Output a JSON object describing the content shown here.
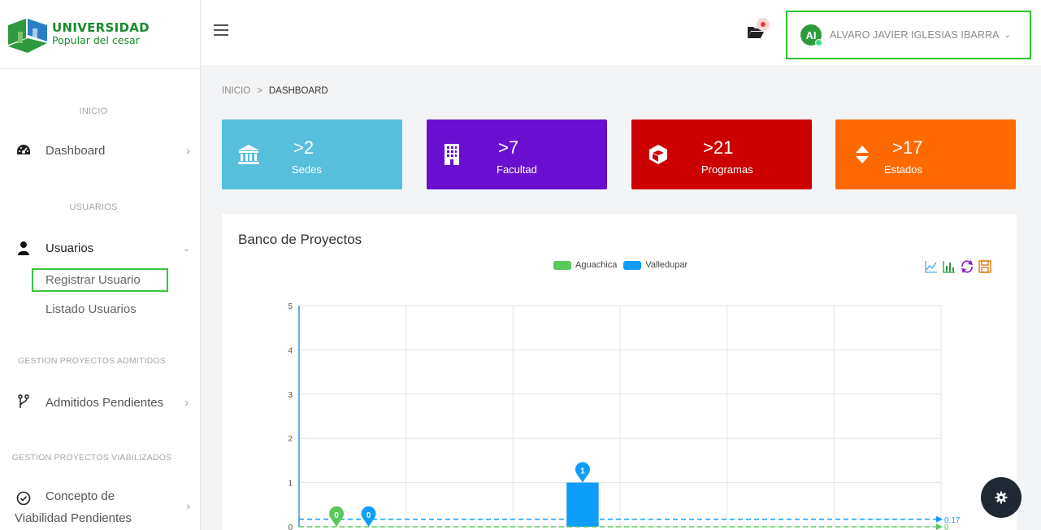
{
  "logo": {
    "line1": "UNIVERSIDAD",
    "line2": "Popular del cesar"
  },
  "sidebar": {
    "sections": [
      {
        "title": "INICIO"
      },
      {
        "title": "USUARIOS"
      },
      {
        "title": "GESTION PROYECTOS ADMITIDOS"
      },
      {
        "title": "GESTION PROYECTOS VIABILIZADOS"
      }
    ],
    "items": [
      {
        "label": "Dashboard",
        "icon": "dashboard-icon"
      },
      {
        "label": "Usuarios",
        "icon": "user-icon"
      },
      {
        "label": "Admitidos Pendientes",
        "icon": "branch-icon"
      },
      {
        "label": "Concepto de",
        "label2": "Viabilidad Pendientes",
        "icon": "check-circle-icon"
      }
    ],
    "sub_items": [
      {
        "label": "Registrar Usuario"
      },
      {
        "label": "Listado Usuarios"
      }
    ]
  },
  "header": {
    "user": {
      "initials": "AI",
      "name": "ALVARO JAVIER IGLESIAS IBARRA"
    }
  },
  "breadcrumb": {
    "home": "INICIO",
    "separator": ">",
    "current": "DASHBOARD"
  },
  "cards": [
    {
      "value": ">2",
      "label": "Sedes",
      "color": "#55bfdc",
      "icon": "bank-icon"
    },
    {
      "value": ">7",
      "label": "Facultad",
      "color": "#6a0fd0",
      "icon": "building-icon"
    },
    {
      "value": ">21",
      "label": "Programas",
      "color": "#cc0000",
      "icon": "cube-icon"
    },
    {
      "value": ">17",
      "label": "Estados",
      "color": "#ff6a00",
      "icon": "sort-icon"
    }
  ],
  "chart": {
    "title": "Banco de Proyectos",
    "toolbox": [
      "line-chart-icon",
      "bar-chart-icon",
      "refresh-icon",
      "save-icon"
    ]
  },
  "chart_data": {
    "type": "bar",
    "categories": [
      "",
      "",
      "",
      "",
      "",
      ""
    ],
    "series": [
      {
        "name": "Aguachica",
        "color": "#5ac85a",
        "values": [
          0,
          0,
          0,
          0,
          0,
          0
        ],
        "markers": [
          {
            "category": 0,
            "value": 0,
            "label": "0"
          }
        ],
        "mark_line": {
          "value": 0,
          "label": "0"
        }
      },
      {
        "name": "Valledupar",
        "color": "#0f9dfa",
        "values": [
          0,
          0,
          1,
          0,
          0,
          0
        ],
        "markers": [
          {
            "category": 0,
            "value": 0,
            "label": "0"
          },
          {
            "category": 2,
            "value": 1,
            "label": "1"
          }
        ],
        "mark_line": {
          "value": 0.17,
          "label": "0.17"
        }
      }
    ],
    "ylim": [
      0,
      5
    ],
    "yticks": [
      "0",
      "1",
      "2",
      "3",
      "4",
      "5"
    ],
    "grid": true,
    "legend_position": "top-center"
  }
}
